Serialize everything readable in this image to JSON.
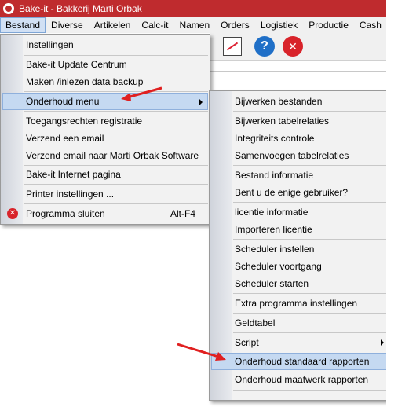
{
  "window": {
    "title": "Bake-it - Bakkerij Marti Orbak"
  },
  "menubar": [
    "Bestand",
    "Diverse",
    "Artikelen",
    "Calc-it",
    "Namen",
    "Orders",
    "Logistiek",
    "Productie",
    "Cash"
  ],
  "toolbar": {
    "help_label": "?",
    "close_label": "✕"
  },
  "bestand_menu": {
    "items": [
      {
        "label": "Instellingen"
      },
      {
        "label": "Bake-it Update Centrum"
      },
      {
        "label": "Maken /inlezen data backup"
      },
      {
        "label": "Onderhoud menu"
      },
      {
        "label": "Toegangsrechten registratie"
      },
      {
        "label": "Verzend een email"
      },
      {
        "label": "Verzend email naar Marti Orbak Software"
      },
      {
        "label": "Bake-it Internet pagina"
      },
      {
        "label": "Printer instellingen ..."
      },
      {
        "label": "Programma sluiten",
        "shortcut": "Alt-F4"
      }
    ]
  },
  "onderhoud_menu": {
    "items": [
      {
        "label": "Bijwerken bestanden"
      },
      {
        "label": "Bijwerken tabelrelaties"
      },
      {
        "label": "Integriteits controle"
      },
      {
        "label": "Samenvoegen tabelrelaties"
      },
      {
        "label": "Bestand informatie"
      },
      {
        "label": "Bent u de enige gebruiker?"
      },
      {
        "label": "licentie informatie"
      },
      {
        "label": "Importeren licentie"
      },
      {
        "label": "Scheduler instellen"
      },
      {
        "label": "Scheduler voortgang"
      },
      {
        "label": "Scheduler starten"
      },
      {
        "label": "Extra programma instellingen"
      },
      {
        "label": "Geldtabel"
      },
      {
        "label": "Script"
      },
      {
        "label": "Onderhoud standaard rapporten"
      },
      {
        "label": "Onderhoud maatwerk rapporten"
      }
    ]
  },
  "colors": {
    "titlebar": "#bf2b2e",
    "highlight": "#c5d9f1",
    "annotation_arrow": "#e02020"
  }
}
